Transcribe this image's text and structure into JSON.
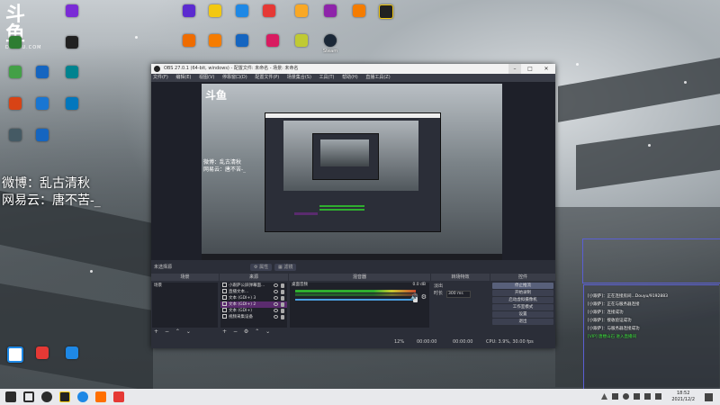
{
  "desktop": {
    "logo": {
      "big": "斗鱼",
      "small": "DOUYU.COM"
    },
    "icons_top": [
      {
        "label": "",
        "color": "#7a2bd6"
      },
      {
        "label": "",
        "color": "#5b2bd0"
      },
      {
        "label": "",
        "color": "#f2c811"
      },
      {
        "label": "",
        "color": "#1e88e5"
      },
      {
        "label": "",
        "color": "#e53935"
      },
      {
        "label": "",
        "color": "#f9a825"
      },
      {
        "label": "",
        "color": "#8e24aa"
      },
      {
        "label": "",
        "color": "#212121"
      }
    ],
    "icons_row2": [
      {
        "label": "",
        "color": "#ef6c00"
      },
      {
        "label": "",
        "color": "#f57c00"
      },
      {
        "label": "",
        "color": "#1565c0"
      },
      {
        "label": "",
        "color": "#d81b60"
      },
      {
        "label": "",
        "color": "#c0ca33"
      },
      {
        "label": "Steam",
        "color": "#1b2838"
      }
    ],
    "icons_left": [
      {
        "label": "",
        "color": "#2e7d32"
      },
      {
        "label": "",
        "color": "#1e88e5"
      },
      {
        "label": "",
        "color": "#43a047"
      },
      {
        "label": "",
        "color": "#1565c0"
      },
      {
        "label": "",
        "color": "#00838f"
      },
      {
        "label": "",
        "color": "#d84315"
      },
      {
        "label": "",
        "color": "#1976d2"
      },
      {
        "label": "",
        "color": "#0277bd"
      },
      {
        "label": "",
        "color": "#455a64"
      },
      {
        "label": "",
        "color": "#1565c0"
      },
      {
        "label": "",
        "color": "#ff8f00"
      },
      {
        "label": "",
        "color": "#e53935"
      },
      {
        "label": "",
        "color": "#1e88e5"
      }
    ],
    "overlay": {
      "line1": "微博：乱古清秋",
      "line2": "网易云：唐不苦-_"
    }
  },
  "obs": {
    "title": "OBS 27.0.1 (64-bit, windows) - 配置文件: 未命名 - 场景: 未命名",
    "menu": [
      "文件(F)",
      "编辑(E)",
      "视图(V)",
      "停靠窗口(D)",
      "配置文件(P)",
      "场景集合(S)",
      "工具(T)",
      "帮助(H)",
      "直播工具(Z)"
    ],
    "scene_bar": {
      "no_source": "未选择源",
      "props": "属性",
      "filters": "滤镜"
    },
    "scenes": {
      "header": "场景",
      "items": [
        "场景"
      ]
    },
    "sources": {
      "header": "来源",
      "items": [
        {
          "label": "小跟萨公屏弹幕面...",
          "type": "browser",
          "selected": false
        },
        {
          "label": "直播文本...",
          "type": "text",
          "selected": false
        },
        {
          "label": "文本 (GDI+) 3",
          "type": "text",
          "selected": false
        },
        {
          "label": "文本 (GDI+) 2",
          "type": "text",
          "selected": true
        },
        {
          "label": "文本 (GDI+)",
          "type": "text",
          "selected": false
        },
        {
          "label": "视频采集设备",
          "type": "camera",
          "selected": false
        }
      ]
    },
    "mixer": {
      "header": "混音器",
      "track": "桌面音频",
      "level": "0.0 dB"
    },
    "transitions": {
      "header": "转场特效",
      "type_label": "淡出",
      "duration_label": "时长",
      "duration_value": "300 ms"
    },
    "controls": {
      "header": "控件",
      "buttons": [
        "停止推流",
        "开始录制",
        "启动虚拟摄像机",
        "工作室模式",
        "设置",
        "退出"
      ]
    },
    "status": {
      "dropped": "12%",
      "live": "00:00:00",
      "rec": "00:00:00",
      "cpu": "CPU: 3.9%, 30.00 fps"
    }
  },
  "chat": {
    "lines": [
      {
        "text": "[小跟萨]：正在连接房间...Douyu/9192883",
        "green": false
      },
      {
        "text": "[小跟萨]：正在与服务器连接",
        "green": false
      },
      {
        "text": "[小跟萨]：连接成功",
        "green": false
      },
      {
        "text": "[小跟萨]：接收验证成功",
        "green": false
      },
      {
        "text": "[小跟萨]：与服务器连接成功",
        "green": false
      },
      {
        "text": "[VIP] 唐楼山石 进入直播间",
        "green": true
      }
    ]
  },
  "taskbar": {
    "time": "18:52",
    "date": "2021/12/2",
    "apps": [
      {
        "name": "windows-start-icon",
        "color": "#2b2b2b"
      },
      {
        "name": "task-view-icon",
        "color": "#2b2b2b"
      },
      {
        "name": "obs-icon",
        "color": "#2b2b2b"
      },
      {
        "name": "app-icon",
        "color": "#222222"
      },
      {
        "name": "edge-icon",
        "color": "#1e88e5"
      },
      {
        "name": "douyu-icon",
        "color": "#ff6f00"
      },
      {
        "name": "app-icon-2",
        "color": "#e53935"
      }
    ]
  }
}
